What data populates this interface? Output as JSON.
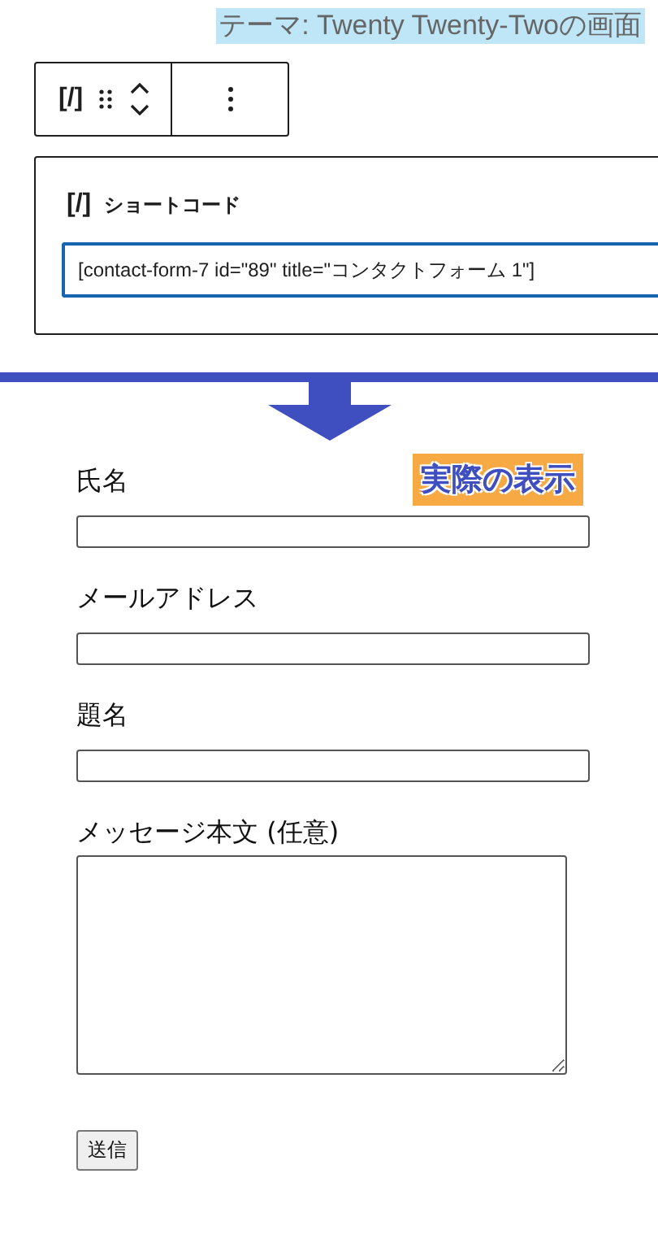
{
  "caption": "テーマ: Twenty Twenty-Twoの画面",
  "toolbar": {
    "block_icon": "[/]"
  },
  "shortcode_block": {
    "icon": "[/]",
    "title": "ショートコード",
    "value": "[contact-form-7 id=\"89\" title=\"コンタクトフォーム 1\"]"
  },
  "badge": "実際の表示",
  "form": {
    "fields": [
      {
        "kind": "text",
        "label": "氏名"
      },
      {
        "kind": "text",
        "label": "メールアドレス"
      },
      {
        "kind": "text",
        "label": "題名"
      },
      {
        "kind": "textarea",
        "label": "メッセージ本文 (任意)"
      }
    ],
    "submit": "送信"
  }
}
